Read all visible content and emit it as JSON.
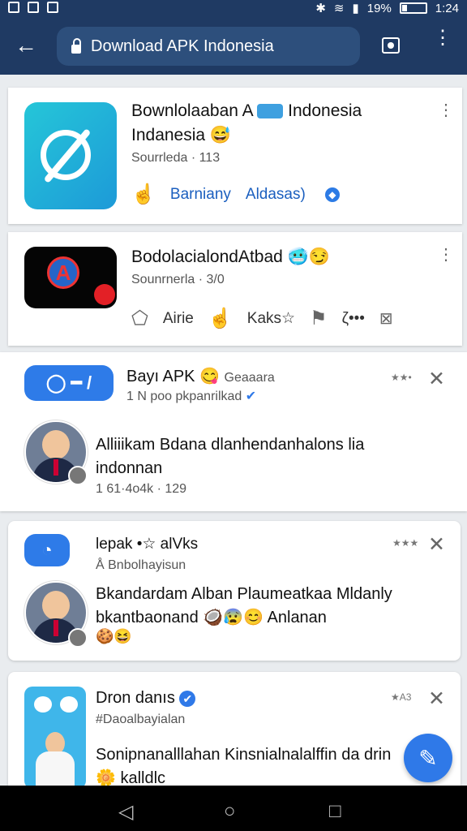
{
  "status_bar": {
    "time": "1:24",
    "battery": "19%"
  },
  "app_bar": {
    "url": "Download APK Indonesia"
  },
  "card1": {
    "title_line1": "Bownlolaaban A",
    "title_line1b": "Indonesia",
    "title_line2": "Indanesia",
    "emoji": "😅",
    "subtitle": "Sourrleda · 113",
    "action_like": "Barniany",
    "action_share": "Aldasas)"
  },
  "card2": {
    "title": "BodolacialondAtbad",
    "subtitle": "Sounrnerla · 3/0",
    "action_1": "Airie",
    "action_2": "Kaks☆",
    "action_3": "ζ•••"
  },
  "card3": {
    "name": "Bayı APK",
    "tag": "Geaaara",
    "handle": "1 N poo pkpanrilkad",
    "text_line1": "Alliiikam Bdana dlanhendanhalons lia",
    "text_line2": "indonnan",
    "stats": "1 61·4o4k · 129"
  },
  "card4": {
    "name": "lepak",
    "emoji_text": "•☆ alVks",
    "handle": "Å Bnbolhayisun",
    "text_line1": "Bkandardam Alban Plaumeatkaa Mldanly",
    "text_line2": "bkantbaonand",
    "text_tail": "Anlanan",
    "stats": "★★★"
  },
  "card5": {
    "name": "Dron danıs",
    "handle": "#Daoalbayialan",
    "text_line1": "Sonipnanalllahan Kinsnialnalalffin da drin",
    "text_line2": "kalldlc",
    "stats": "★A3"
  },
  "colors": {
    "appbar": "#1f3a63",
    "accent": "#2f79e8"
  }
}
